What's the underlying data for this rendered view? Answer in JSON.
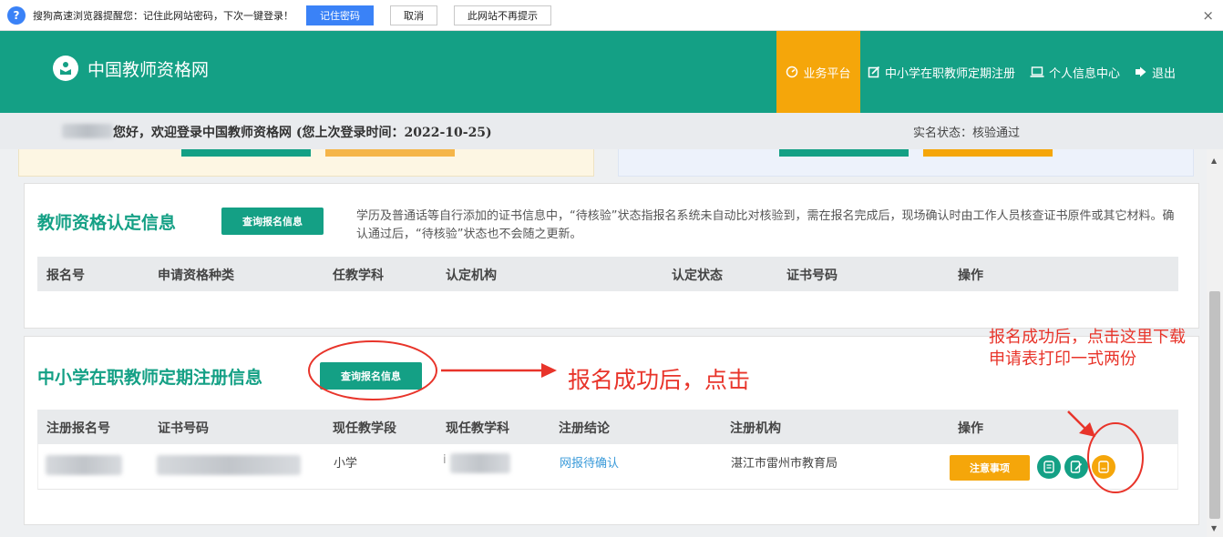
{
  "browser_bar": {
    "message": "搜狗高速浏览器提醒您：记住此网站密码，下次一键登录！",
    "remember_label": "记住密码",
    "cancel_label": "取消",
    "never_label": "此网站不再提示",
    "close_glyph": "×"
  },
  "header": {
    "site_title": "中国教师资格网",
    "nav": {
      "platform": "业务平台",
      "registration": "中小学在职教师定期注册",
      "profile": "个人信息中心",
      "logout": "退出"
    }
  },
  "welcome": {
    "text": "您好，欢迎登录中国教师资格网 (您上次登录时间：2022-10-25)",
    "realname_status": "实名状态：核验通过"
  },
  "cert_card": {
    "title": "教师资格认定信息",
    "query_button": "查询报名信息",
    "note": "学历及普通话等自行添加的证书信息中，“待核验”状态指报名系统未自动比对核验到，需在报名完成后，现场确认时由工作人员核查证书原件或其它材料。确认通过后，“待核验”状态也不会随之更新。",
    "columns": [
      "报名号",
      "申请资格种类",
      "任教学科",
      "认定机构",
      "认定状态",
      "证书号码",
      "操作"
    ]
  },
  "reg_card": {
    "title": "中小学在职教师定期注册信息",
    "query_button": "查询报名信息",
    "columns": [
      "注册报名号",
      "证书号码",
      "现任教学段",
      "现任教学科",
      "注册结论",
      "注册机构",
      "操作"
    ],
    "row": {
      "stage": "小学",
      "subject_prefix": "i",
      "conclusion": "网报待确认",
      "agency": "湛江市雷州市教育局",
      "notice_button": "注意事项"
    }
  },
  "annotations": {
    "click_hint": "报名成功后，点击",
    "download_hint": "报名成功后，点击这里下载申请表打印一式两份"
  },
  "colors": {
    "brand_green": "#14a085",
    "accent_orange": "#f5a60a",
    "annotation_red": "#e8342a",
    "link_blue": "#3a9ad9"
  }
}
